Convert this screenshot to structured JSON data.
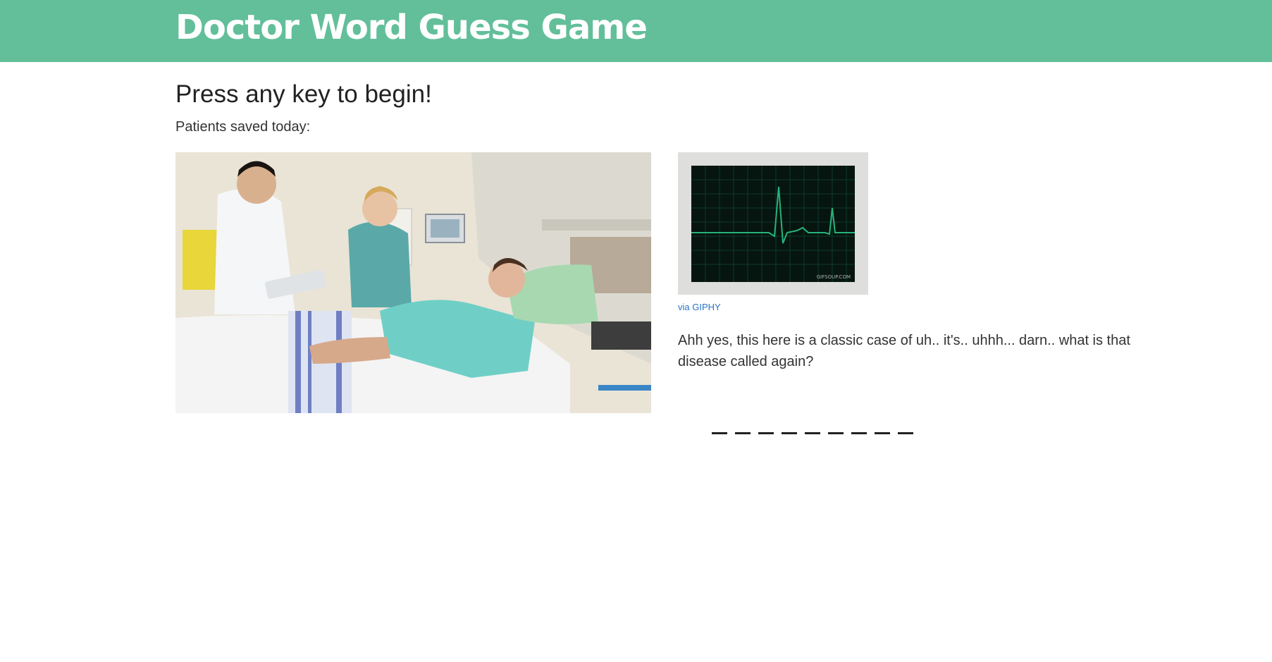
{
  "header": {
    "title": "Doctor Word Guess Game"
  },
  "game": {
    "prompt": "Press any key to begin!",
    "score_label": "Patients saved today:",
    "score_value": "",
    "blanks": [
      "_",
      "_",
      "_",
      "_",
      "_",
      "_",
      "_",
      "_",
      "_"
    ]
  },
  "media": {
    "photo_name": "hospital-room-photo",
    "gif_name": "heart-monitor-gif",
    "gif_watermark": "GIFSOUP.COM",
    "giphy_link": "via GIPHY"
  },
  "dialogue": {
    "text": "Ahh yes, this here is a classic case of uh.. it's.. uhhh... darn.. what is that disease called again?"
  },
  "colors": {
    "header_bg": "#62bf9a",
    "link": "#2a73c8",
    "monitor_line": "#27b27a"
  }
}
